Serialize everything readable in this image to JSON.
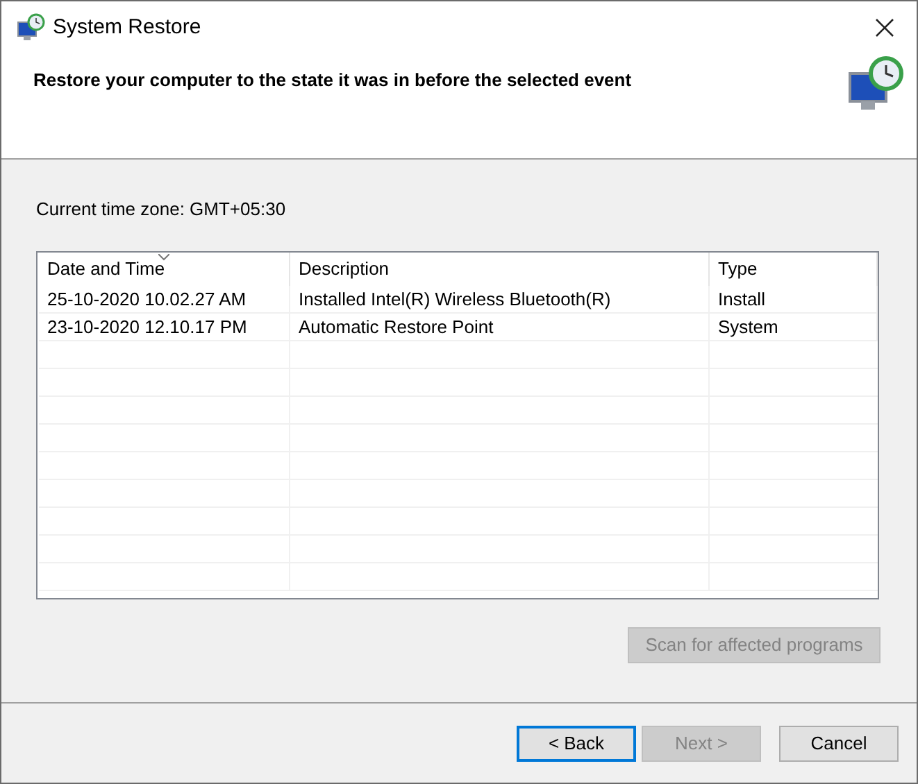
{
  "window": {
    "title": "System Restore"
  },
  "header": {
    "heading": "Restore your computer to the state it was in before the selected event"
  },
  "time_zone": "Current time zone: GMT+05:30",
  "table": {
    "columns": [
      {
        "label": "Date and Time",
        "sorted": true
      },
      {
        "label": "Description",
        "sorted": false
      },
      {
        "label": "Type",
        "sorted": false
      }
    ],
    "rows": [
      {
        "cells": [
          "25-10-2020 10.02.27 AM",
          "Installed Intel(R) Wireless Bluetooth(R)",
          "Install"
        ],
        "selected": false
      },
      {
        "cells": [
          "23-10-2020 12.10.17 PM",
          "Automatic Restore Point",
          "System"
        ],
        "selected": false
      }
    ]
  },
  "scan_button": {
    "label": "Scan for affected programs",
    "disabled": true
  },
  "buttons": [
    {
      "label": "< Back",
      "disabled": false,
      "focused": true
    },
    {
      "label": "Next >",
      "disabled": true,
      "focused": false
    },
    {
      "label": "Cancel",
      "disabled": false,
      "focused": false
    }
  ]
}
